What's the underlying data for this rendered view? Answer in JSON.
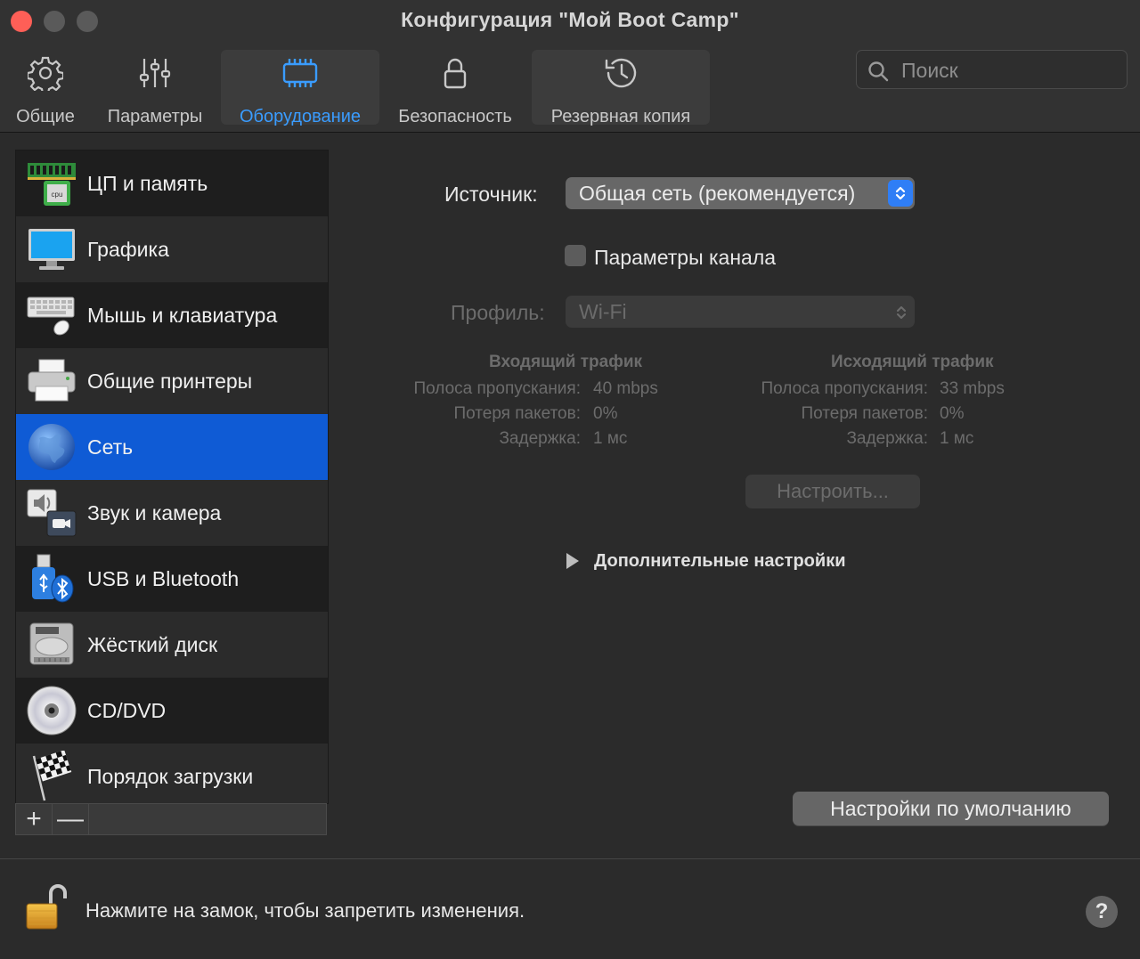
{
  "window": {
    "title": "Конфигурация \"Мой Boot Camp\""
  },
  "toolbar": {
    "tabs": [
      {
        "label": "Общие",
        "icon": "gear-icon"
      },
      {
        "label": "Параметры",
        "icon": "sliders-icon"
      },
      {
        "label": "Оборудование",
        "icon": "chip-icon"
      },
      {
        "label": "Безопасность",
        "icon": "lock-icon"
      },
      {
        "label": "Резервная копия",
        "icon": "history-icon"
      }
    ],
    "active_tab": "Оборудование",
    "search_placeholder": "Поиск"
  },
  "sidebar": {
    "items": [
      {
        "label": "ЦП и память",
        "icon": "cpu-memory-icon"
      },
      {
        "label": "Графика",
        "icon": "monitor-icon"
      },
      {
        "label": "Мышь и клавиатура",
        "icon": "keyboard-mouse-icon"
      },
      {
        "label": "Общие принтеры",
        "icon": "printer-icon"
      },
      {
        "label": "Сеть",
        "icon": "globe-icon"
      },
      {
        "label": "Звук и камера",
        "icon": "sound-camera-icon"
      },
      {
        "label": "USB и Bluetooth",
        "icon": "usb-bluetooth-icon"
      },
      {
        "label": "Жёсткий диск",
        "icon": "hard-disk-icon"
      },
      {
        "label": "CD/DVD",
        "icon": "disc-icon"
      },
      {
        "label": "Порядок загрузки",
        "icon": "checkered-flag-icon"
      }
    ],
    "selected": "Сеть",
    "add_label": "+",
    "remove_label": "—"
  },
  "network": {
    "source_label": "Источник:",
    "source_value": "Общая сеть (рекомендуется)",
    "channel_params_label": "Параметры канала",
    "channel_params_checked": false,
    "profile_label": "Профиль:",
    "profile_value": "Wi-Fi",
    "incoming": {
      "title": "Входящий трафик",
      "rows": [
        {
          "key": "Полоса пропускания:",
          "value": "40 mbps"
        },
        {
          "key": "Потеря пакетов:",
          "value": "0%"
        },
        {
          "key": "Задержка:",
          "value": "1 мс"
        }
      ]
    },
    "outgoing": {
      "title": "Исходящий трафик",
      "rows": [
        {
          "key": "Полоса пропускания:",
          "value": "33 mbps"
        },
        {
          "key": "Потеря пакетов:",
          "value": "0%"
        },
        {
          "key": "Задержка:",
          "value": "1 мс"
        }
      ]
    },
    "configure_button": "Настроить...",
    "advanced_label": "Дополнительные настройки",
    "defaults_button": "Настройки по умолчанию"
  },
  "footer": {
    "lock_text": "Нажмите на замок, чтобы запретить изменения.",
    "help_label": "?"
  },
  "colors": {
    "accent": "#0f5bd5",
    "active_tab_text": "#3a9cff",
    "close_button": "#fe5f57"
  }
}
